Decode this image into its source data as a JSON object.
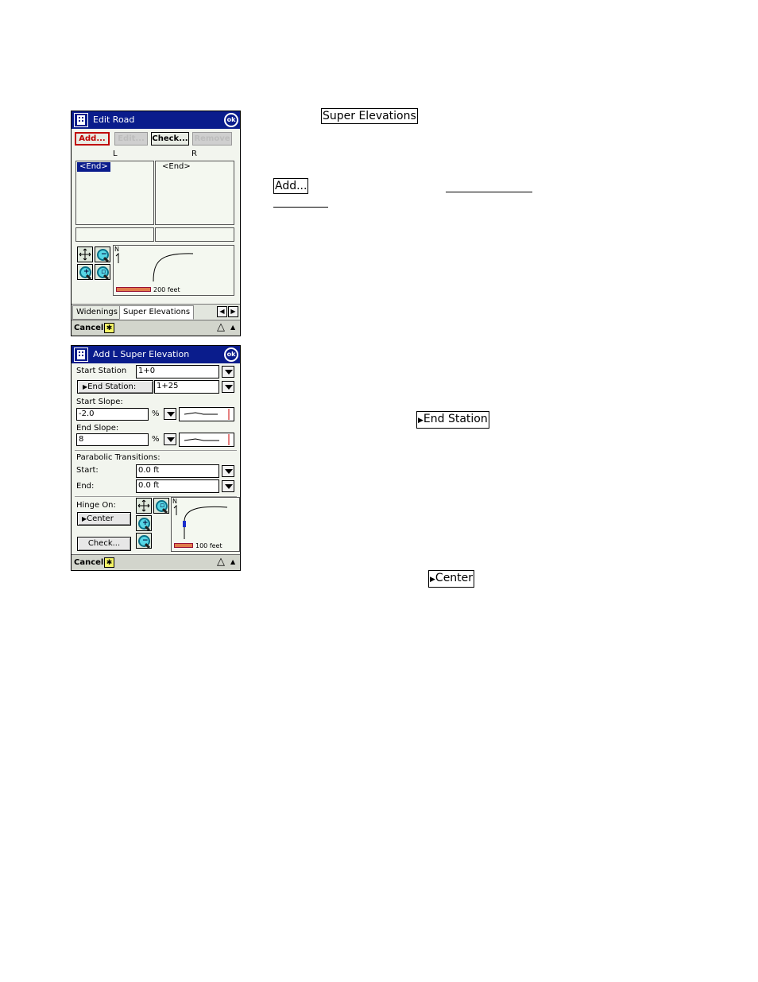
{
  "doc": {
    "key_super_elevations": "Super Elevations",
    "key_add": "Add...",
    "key_end_station": "End Station",
    "key_center": "Center"
  },
  "screen1": {
    "title": "Edit Road",
    "ok": "ok",
    "buttons": {
      "add": "Add...",
      "edit": "Edit...",
      "check": "Check...",
      "remove": "Remove"
    },
    "col_left": "L",
    "col_right": "R",
    "left_list": [
      "<End>"
    ],
    "right_list": [
      "<End>"
    ],
    "map": {
      "north": "N",
      "scale": "200 feet"
    },
    "tabs": [
      "Widenings",
      "Super Elevations"
    ],
    "cancel": "Cancel"
  },
  "screen2": {
    "title": "Add L Super Elevation",
    "ok": "ok",
    "start_station_label": "Start Station",
    "start_station_value": "1+0",
    "end_station_label": "End Station:",
    "end_station_value": "1+25",
    "start_slope_label": "Start Slope:",
    "start_slope_value": "-2.0",
    "end_slope_label": "End Slope:",
    "end_slope_value": "8",
    "percent": "%",
    "parabolic_label": "Parabolic Transitions:",
    "par_start_label": "Start:",
    "par_start_value": "0.0 ft",
    "par_end_label": "End:",
    "par_end_value": "0.0 ft",
    "hinge_label": "Hinge On:",
    "hinge_value": "Center",
    "check": "Check...",
    "map": {
      "north": "N",
      "scale": "100 feet"
    },
    "cancel": "Cancel"
  }
}
